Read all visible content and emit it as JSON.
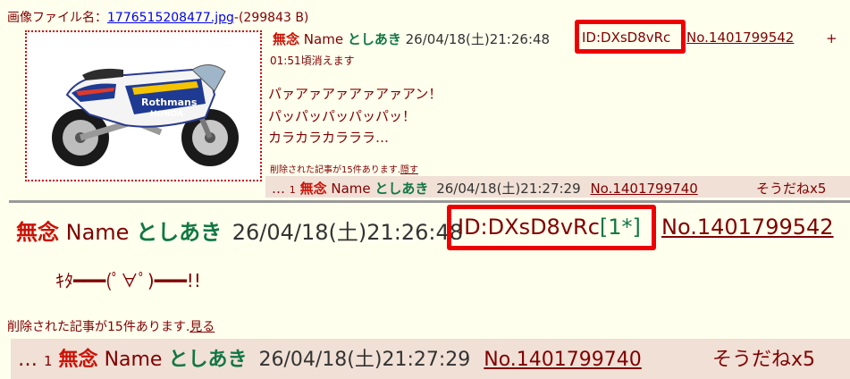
{
  "file": {
    "label": "画像ファイル名：",
    "filename": "1776515208477.jpg",
    "size": "-(299843 B)"
  },
  "op": {
    "subject": "無念",
    "name_label": "Name",
    "name": "としあき",
    "datetime": "26/04/18(土)21:26:48",
    "id": "ID:DXsD8vRc",
    "number": "No.1401799542",
    "plus": "+",
    "expire": "01:51頃消えます",
    "lines": [
      "パァアァアァアァアァアン！",
      "パッパッパッパッパッ！",
      "カラカラカラララ…"
    ],
    "deleted_notice": "削除された記事が15件あります.",
    "hide_link": "隠す"
  },
  "reply_preview": {
    "ellipsis": "…",
    "index": "1",
    "subject": "無念",
    "name_label": "Name",
    "name": "としあき",
    "datetime": "26/04/18(土)21:27:29",
    "number": "No.1401799740",
    "sodane": "そうだねx5"
  },
  "zoom": {
    "subject": "無念",
    "name_label": "Name",
    "name": "としあき",
    "datetime": "26/04/18(土)21:26:48",
    "id": "ID:DXsD8vRc",
    "id_count": "[1*]",
    "number": "No.1401799542",
    "body": "ｷﾀ━━━(ﾟ∀ﾟ)━━━!!",
    "deleted_notice": "削除された記事が15件あります.",
    "show_link": "見る"
  },
  "colors": {
    "background": "#ffffee",
    "reply_background": "#f0e0d6",
    "subject": "#cc1105",
    "name": "#117743",
    "text": "#800000",
    "highlight_border": "#ee0000",
    "link": "#0000ee"
  }
}
